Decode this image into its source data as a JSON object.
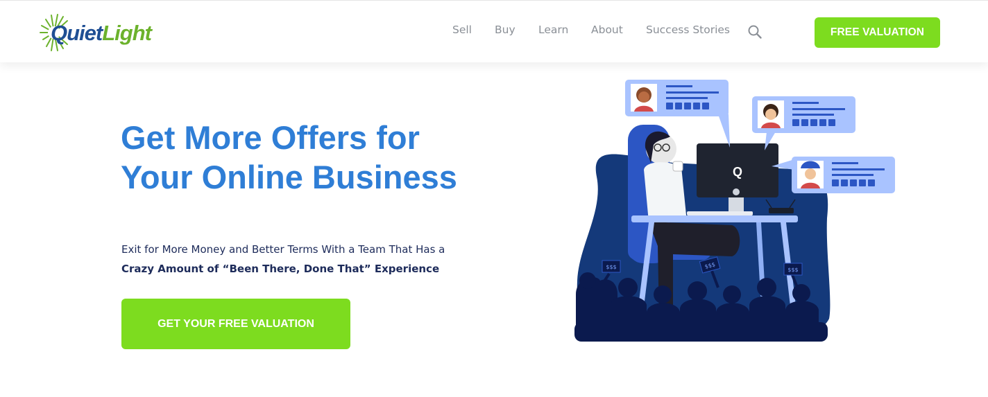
{
  "brand": {
    "logo_part1": "Quiet",
    "logo_part2": "Light"
  },
  "nav": {
    "items": [
      {
        "label": "Sell"
      },
      {
        "label": "Buy"
      },
      {
        "label": "Learn"
      },
      {
        "label": "About"
      },
      {
        "label": "Success Stories"
      }
    ],
    "search_icon": "search-icon",
    "cta_label": "FREE VALUATION"
  },
  "hero": {
    "title_line1": "Get More Offers for",
    "title_line2": "Your Online Business",
    "subtitle_line1": "Exit for More Money and Better Terms With a Team That Has a",
    "subtitle_line2": "Crazy Amount of “Been There, Done That” Experience",
    "cta_label": "GET YOUR FREE VALUATION"
  },
  "illustration": {
    "monitor_logo": "Q",
    "bid_sign_text": "$$$",
    "review_count": 3,
    "stars_per_review": 5
  },
  "colors": {
    "brand_blue": "#2f7ed6",
    "brand_green": "#7ddc1f",
    "navy": "#1d2b5a",
    "nav_grey": "#8a8f96"
  }
}
